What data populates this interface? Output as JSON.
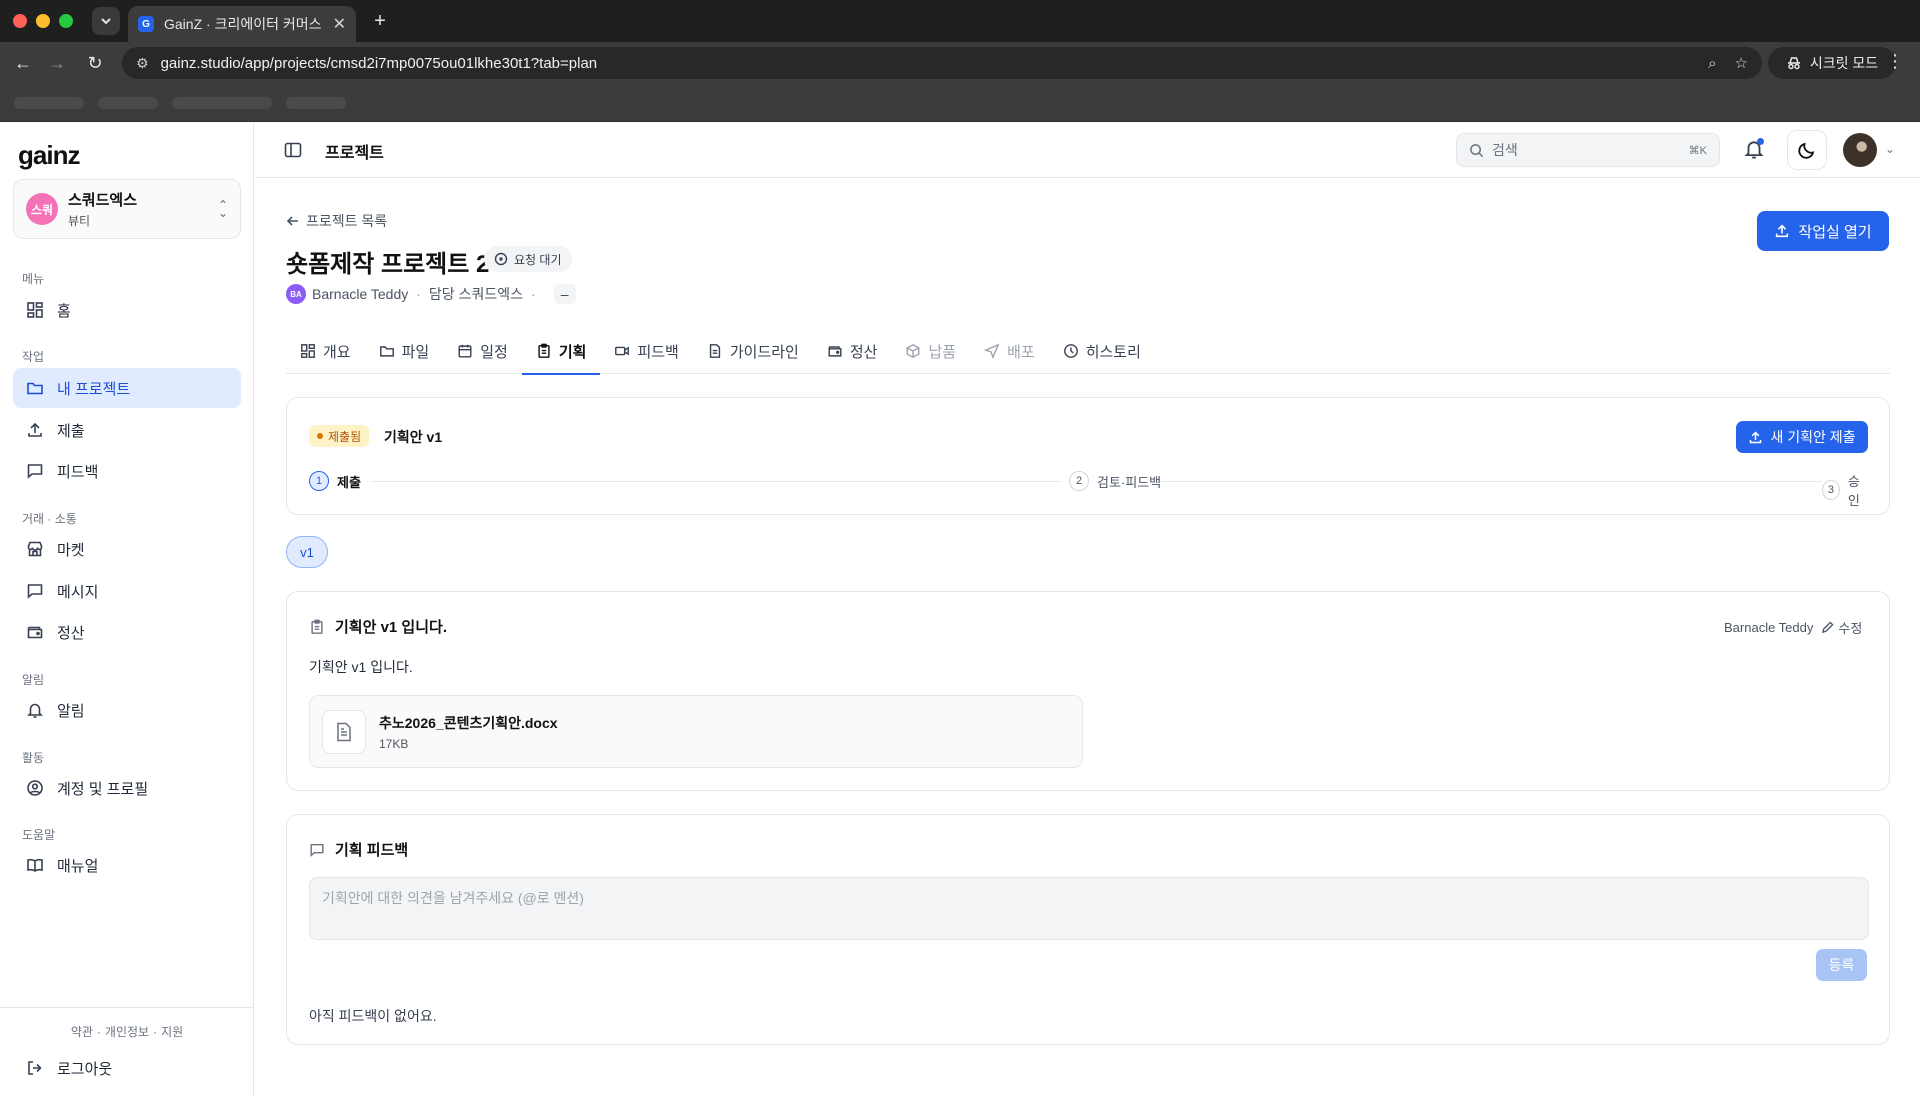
{
  "browser": {
    "tab_title": "GainZ · 크리에이터 커머스 협업 C",
    "favicon_letter": "G",
    "url": "gainz.studio/app/projects/cmsd2i7mp0075ou01lkhe30t1?tab=plan",
    "incognito_label": "시크릿 모드"
  },
  "sidebar": {
    "logo": "gainz",
    "workspace": {
      "avatar_text": "스쿼",
      "name": "스쿼드엑스",
      "category": "뷰티"
    },
    "sections": {
      "menu": "메뉴",
      "work": "작업",
      "trade": "거래 · 소통",
      "alerts": "알림",
      "activity": "활동",
      "help": "도움말"
    },
    "items": {
      "home": "홈",
      "my_projects": "내 프로젝트",
      "submit": "제출",
      "feedback": "피드백",
      "market": "마켓",
      "messages": "메시지",
      "settlement": "정산",
      "notifications": "알림",
      "account": "계정 및 프로필",
      "manual": "매뉴얼"
    },
    "footer": {
      "terms": "약관",
      "privacy": "개인정보",
      "support": "지원",
      "logout": "로그아웃"
    }
  },
  "topbar": {
    "title": "프로젝트",
    "search_placeholder": "검색",
    "search_shortcut": "⌘K"
  },
  "project": {
    "back_label": "프로젝트 목록",
    "title": "숏폼제작 프로젝트 2",
    "status": "요청 대기",
    "creator_initials": "BA",
    "creator_name": "Barnacle Teddy",
    "manager": "담당 스쿼드엑스",
    "extra": "–",
    "open_studio_label": "작업실 열기",
    "tabs": {
      "overview": "개요",
      "files": "파일",
      "schedule": "일정",
      "plan": "기획",
      "feedback": "피드백",
      "guideline": "가이드라인",
      "settlement": "정산",
      "delivery": "납품",
      "distribution": "배포",
      "history": "히스토리"
    }
  },
  "plan_status": {
    "badge": "제출됨",
    "version_title": "기획안 v1",
    "new_plan_label": "새 기획안 제출",
    "steps": [
      {
        "num": "1",
        "label": "제출"
      },
      {
        "num": "2",
        "label": "검토·피드백"
      },
      {
        "num": "3",
        "label": "승인"
      }
    ]
  },
  "version_chip": "v1",
  "plan": {
    "heading": "기획안 v1 입니다.",
    "author": "Barnacle Teddy",
    "edit_label": "수정",
    "body": "기획안 v1 입니다.",
    "file_name": "추노2026_콘텐츠기획안.docx",
    "file_size": "17KB"
  },
  "plan_feedback": {
    "heading": "기획 피드백",
    "placeholder": "기획안에 대한 의견을 남겨주세요 (@로 멘션)",
    "submit_label": "등록",
    "empty_text": "아직 피드백이 없어요."
  },
  "colors": {
    "accent": "#2563eb",
    "active_bg": "#e0ebff",
    "badge_bg": "#fef3c7",
    "badge_text": "#b45309"
  }
}
